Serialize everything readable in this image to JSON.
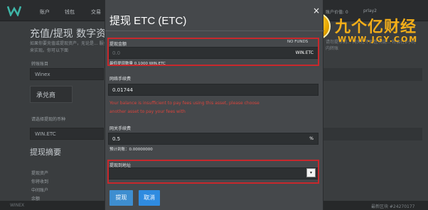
{
  "topnav": {
    "items": [
      "账户",
      "钱包",
      "交易"
    ],
    "right_info": "账户价值: 0",
    "user": "prlay2"
  },
  "page": {
    "title": "充值/提现 数字资产",
    "desc": "如果你要充值或提现资产，无论是... 服务来实现。你可以下面",
    "label_account": "转账账目",
    "account_value": "Winex",
    "box_label": "承兑商",
    "label_asset": "请选择提现的币种",
    "asset_value": "WIN.ETC",
    "summary_title": "提现摘要",
    "summary_items": [
      "提现资产",
      "你将收到",
      "中间账户",
      "余额"
    ],
    "right_text": "请勿提币到... 网关在不同区块链... 将会在2小时内转账",
    "bottom_left": "WINEX",
    "bottom_right": "最新区块 #24270177"
  },
  "watermark": {
    "coin_char": "9",
    "title": "九个亿财经",
    "url": "WWW.JGY.COM"
  },
  "modal": {
    "title": "提现 ETC (ETC)",
    "close": "×",
    "amount_label": "提现金额",
    "no_funds": "NO FUNDS",
    "amount_placeholder": "0.0",
    "amount_asset": "WIN.ETC",
    "min_hint": "最低提现数量 0.1000 WIN.ETC",
    "fee_label": "网络手续费",
    "fee_value": "0.01744",
    "error_text": "Your balance is insufficient to pay fees using this asset, please choose another asset to pay your fees with",
    "gateway_fee_label": "网关手续费",
    "gateway_fee_value": "0.5",
    "gateway_fee_unit": "%",
    "estimate_hint": "预计到账：0.00000000",
    "address_label": "提现到地址",
    "address_value": "",
    "arrow": "▾",
    "submit_label": "提现",
    "cancel_label": "取消"
  }
}
